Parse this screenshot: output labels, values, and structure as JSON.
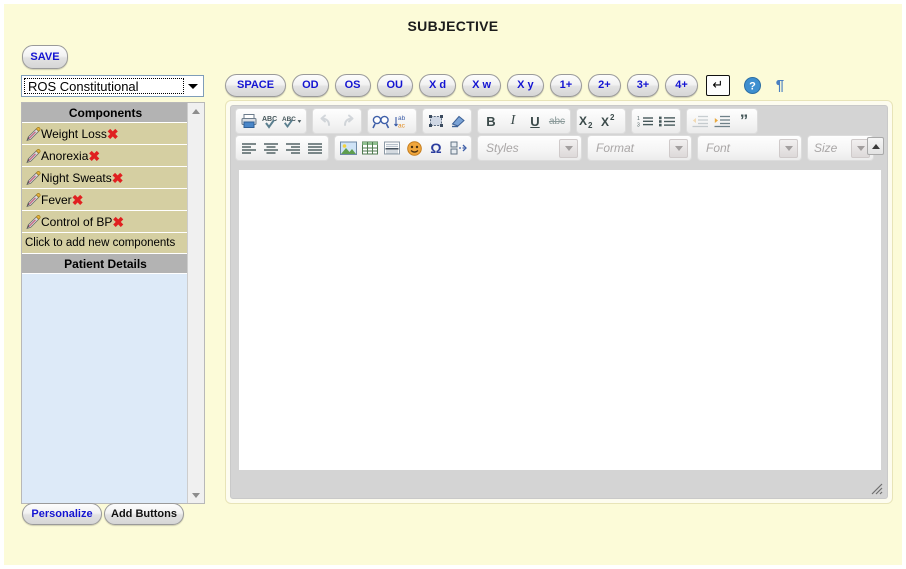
{
  "page": {
    "title": "SUBJECTIVE",
    "background_color": "#fcfbd8",
    "accent_color": "#1414d2"
  },
  "toolbar_top": {
    "save_label": "SAVE",
    "section_select": {
      "value": "ROS Constitutional",
      "arrow_icon": "chevron-down-icon"
    }
  },
  "macro_buttons": [
    {
      "label": "SPACE",
      "name": "macro-space"
    },
    {
      "label": "OD",
      "name": "macro-od"
    },
    {
      "label": "OS",
      "name": "macro-os"
    },
    {
      "label": "OU",
      "name": "macro-ou"
    },
    {
      "label": "X d",
      "name": "macro-xd"
    },
    {
      "label": "X w",
      "name": "macro-xw"
    },
    {
      "label": "X y",
      "name": "macro-xy"
    },
    {
      "label": "1+",
      "name": "macro-1plus"
    },
    {
      "label": "2+",
      "name": "macro-2plus"
    },
    {
      "label": "3+",
      "name": "macro-3plus"
    },
    {
      "label": "4+",
      "name": "macro-4plus"
    }
  ],
  "macro_extras": {
    "enter_key_glyph": "↵",
    "enter_key_icon": "enter-key-icon",
    "help_icon": "help-circle-icon",
    "help_glyph": "?",
    "pilcrow_icon": "pilcrow-icon",
    "pilcrow_glyph": "¶"
  },
  "sidebar": {
    "components_header": "Components",
    "components": [
      {
        "label": "Weight Loss",
        "edit_icon": "pencil-icon",
        "delete_glyph": "✖"
      },
      {
        "label": "Anorexia",
        "edit_icon": "pencil-icon",
        "delete_glyph": "✖"
      },
      {
        "label": "Night Sweats",
        "edit_icon": "pencil-icon",
        "delete_glyph": "✖"
      },
      {
        "label": "Fever",
        "edit_icon": "pencil-icon",
        "delete_glyph": "✖"
      },
      {
        "label": "Control of BP",
        "edit_icon": "pencil-icon",
        "delete_glyph": "✖"
      }
    ],
    "add_new_label": "Click to add new components",
    "patient_details_header": "Patient Details",
    "scrollbar": {
      "up_icon": "scroll-up-arrow-icon",
      "down_icon": "scroll-down-arrow-icon"
    }
  },
  "bottom_buttons": {
    "personalize_label": "Personalize",
    "add_buttons_label": "Add Buttons"
  },
  "editor": {
    "content": "",
    "toolbar_row1": [
      {
        "name": "print-icon",
        "title": "Print",
        "disabled": false
      },
      {
        "name": "spell-check-icon",
        "title": "Check Spelling",
        "disabled": false
      },
      {
        "name": "spell-check-options-icon",
        "title": "Spell Check Options",
        "disabled": false
      },
      {
        "name": "undo-icon",
        "title": "Undo",
        "disabled": true
      },
      {
        "name": "redo-icon",
        "title": "Redo",
        "disabled": true
      },
      {
        "name": "find-icon",
        "title": "Find",
        "disabled": false
      },
      {
        "name": "replace-icon",
        "title": "Replace",
        "disabled": false
      },
      {
        "name": "select-all-icon",
        "title": "Select All",
        "disabled": false
      },
      {
        "name": "remove-format-icon",
        "title": "Remove Format",
        "disabled": false
      },
      {
        "name": "bold-icon",
        "title": "Bold",
        "glyph": "B",
        "disabled": false
      },
      {
        "name": "italic-icon",
        "title": "Italic",
        "glyph": "I",
        "disabled": false
      },
      {
        "name": "underline-icon",
        "title": "Underline",
        "glyph": "U",
        "disabled": false
      },
      {
        "name": "strikethrough-icon",
        "title": "Strike Through",
        "glyph": "abc",
        "disabled": false
      },
      {
        "name": "subscript-icon",
        "title": "Subscript",
        "disabled": false
      },
      {
        "name": "superscript-icon",
        "title": "Superscript",
        "disabled": false
      },
      {
        "name": "numbered-list-icon",
        "title": "Insert/Remove Numbered List",
        "disabled": false
      },
      {
        "name": "bulleted-list-icon",
        "title": "Insert/Remove Bulleted List",
        "disabled": false
      },
      {
        "name": "decrease-indent-icon",
        "title": "Decrease Indent",
        "disabled": true
      },
      {
        "name": "increase-indent-icon",
        "title": "Increase Indent",
        "disabled": false
      },
      {
        "name": "blockquote-icon",
        "title": "Block Quote",
        "glyph": "”",
        "disabled": false
      }
    ],
    "toolbar_row2": [
      {
        "name": "align-left-icon",
        "title": "Align Left"
      },
      {
        "name": "align-center-icon",
        "title": "Center"
      },
      {
        "name": "align-right-icon",
        "title": "Align Right"
      },
      {
        "name": "justify-icon",
        "title": "Justify"
      },
      {
        "name": "image-icon",
        "title": "Image"
      },
      {
        "name": "table-icon",
        "title": "Table"
      },
      {
        "name": "horizontal-rule-icon",
        "title": "Horizontal Line"
      },
      {
        "name": "smiley-icon",
        "title": "Smiley"
      },
      {
        "name": "special-char-icon",
        "title": "Insert Special Character",
        "glyph": "Ω"
      },
      {
        "name": "page-break-icon",
        "title": "Page Break"
      }
    ],
    "combos": [
      {
        "name": "styles-combo",
        "label": "Styles"
      },
      {
        "name": "format-combo",
        "label": "Format"
      },
      {
        "name": "font-combo",
        "label": "Font"
      },
      {
        "name": "size-combo",
        "label": "Size"
      }
    ],
    "collapse_icon": "collapse-toolbar-icon",
    "resize_icon": "resize-grip-icon"
  }
}
